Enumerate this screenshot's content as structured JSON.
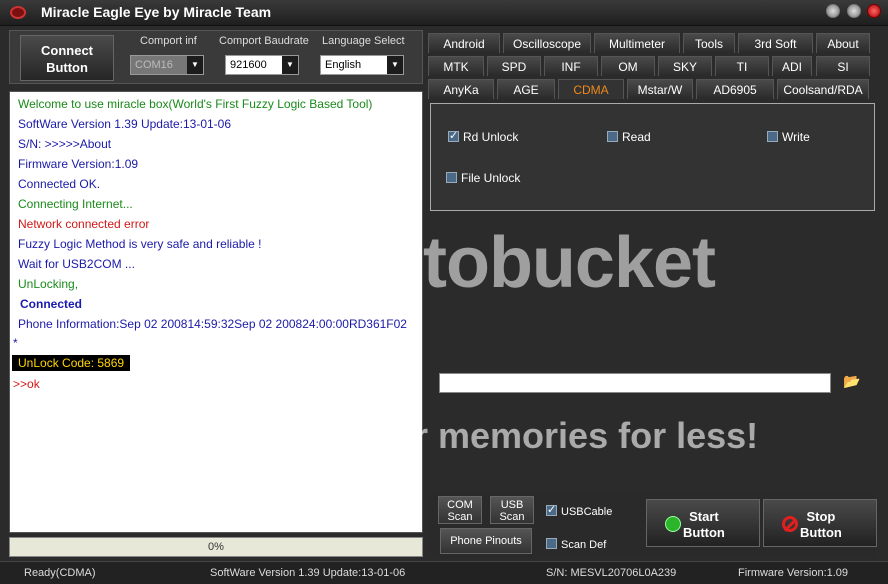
{
  "window": {
    "title": "Miracle Eagle Eye by Miracle Team"
  },
  "connect": {
    "button_label": "Connect\nButton"
  },
  "comport": {
    "label": "Comport inf",
    "value": "COM16"
  },
  "baudrate": {
    "label": "Comport Baudrate",
    "value": "921600"
  },
  "language": {
    "label": "Language Select",
    "value": "English"
  },
  "log": [
    "Welcome to use miracle box(World's First Fuzzy Logic Based Tool)",
    "SoftWare Version 1.39  Update:13-01-06",
    "S/N: >>>>>About",
    "Firmware Version:1.09",
    "Connected OK.",
    "Connecting Internet...",
    "Network connected error",
    "Fuzzy Logic Method is very safe and reliable !",
    "Wait for USB2COM ...",
    "UnLocking,",
    "Connected",
    "Phone Information:Sep 02 200814:59:32Sep 02 200824:00:00RD361F02",
    "*",
    "UnLock Code: 5869",
    ">>ok"
  ],
  "progress": {
    "text": "0%",
    "value": 0
  },
  "tabs": {
    "row1": [
      "Android",
      "Oscilloscope",
      "Multimeter",
      "Tools",
      "3rd Soft",
      "About"
    ],
    "row2": [
      "MTK",
      "SPD",
      "INF",
      "OM",
      "SKY",
      "TI",
      "ADI",
      "SI"
    ],
    "row3": [
      "AnyKa",
      "AGE",
      "CDMA",
      "Mstar/W",
      "AD6905",
      "Coolsand/RDA"
    ],
    "active": "CDMA"
  },
  "cdma": {
    "rd_unlock": {
      "label": "Rd Unlock",
      "checked": true
    },
    "read": {
      "label": "Read",
      "checked": false
    },
    "write": {
      "label": "Write",
      "checked": false
    },
    "file_unlock": {
      "label": "File Unlock",
      "checked": false
    }
  },
  "watermark": {
    "line1": "otobucket",
    "line2": "ur memories for less!"
  },
  "file_path": {
    "value": ""
  },
  "bottom": {
    "com_scan": "COM\nScan",
    "usb_scan": "USB\nScan",
    "usb_cable": {
      "label": "USBCable",
      "checked": true
    },
    "phone_pinouts": "Phone Pinouts",
    "scan_def": {
      "label": "Scan Def",
      "checked": false
    },
    "start": "Start\nButton",
    "stop": "Stop\nButton"
  },
  "status": {
    "state": "Ready(CDMA)",
    "software": "SoftWare Version 1.39  Update:13-01-06",
    "sn": "S/N: MESVL20706L0A239",
    "firmware": "Firmware Version:1.09"
  }
}
